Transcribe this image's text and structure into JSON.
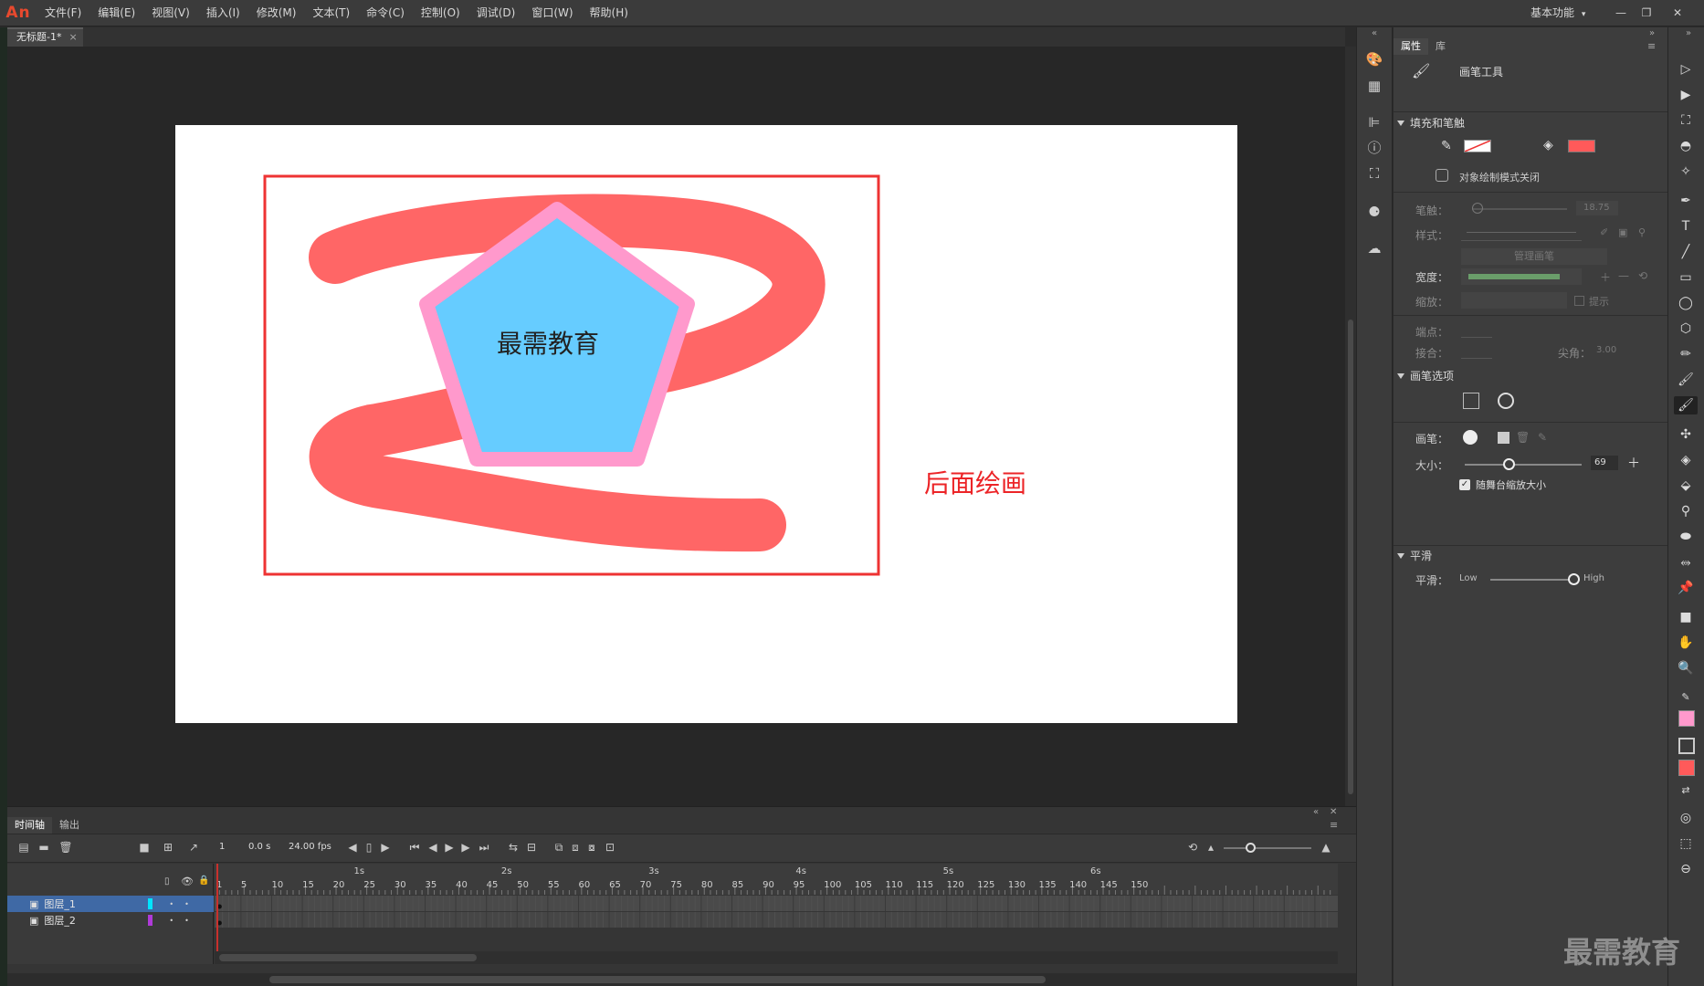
{
  "app": {
    "logo": "An",
    "workspace": "基本功能"
  },
  "menu": [
    "文件(F)",
    "编辑(E)",
    "视图(V)",
    "插入(I)",
    "修改(M)",
    "文本(T)",
    "命令(C)",
    "控制(O)",
    "调试(D)",
    "窗口(W)",
    "帮助(H)"
  ],
  "document": {
    "tab_title": "无标题-1*",
    "tab_close": "×"
  },
  "stage": {
    "shape_text": "最需教育",
    "annotation": "后面绘画",
    "colors": {
      "stroke": "#ff6666",
      "pentagon_fill": "#66ccff",
      "pentagon_stroke": "#ff99cc",
      "box": "#ee3333"
    }
  },
  "timeline": {
    "tabs": [
      "时间轴",
      "输出"
    ],
    "current_frame": "1",
    "time": "0.0 s",
    "fps": "24.00 fps",
    "seconds": [
      "1s",
      "2s",
      "3s",
      "4s",
      "5s",
      "6s"
    ],
    "frame_numbers": [
      "1",
      "5",
      "10",
      "15",
      "20",
      "25",
      "30",
      "35",
      "40",
      "45",
      "50",
      "55",
      "60",
      "65",
      "70",
      "75",
      "80",
      "85",
      "90",
      "95",
      "100",
      "105",
      "110",
      "115",
      "120",
      "125",
      "130",
      "135",
      "140",
      "145",
      "150"
    ],
    "layers": [
      {
        "name": "图层_1",
        "color": "#00e5ff",
        "selected": true
      },
      {
        "name": "图层_2",
        "color": "#b03ad9",
        "selected": false
      }
    ]
  },
  "properties": {
    "tabs": [
      "属性",
      "库"
    ],
    "tool_name": "画笔工具",
    "fill_stroke": {
      "header": "填充和笔触",
      "stroke_color": "none",
      "fill_color": "#ff5a5a",
      "draw_mode": "对象绘制模式关闭",
      "stroke_label": "笔触：",
      "stroke_value": "18.75",
      "style_label": "样式：",
      "manage_brush": "管理画笔",
      "width_label": "宽度：",
      "scale_label": "缩放：",
      "hint_label": "提示",
      "cap_label": "端点：",
      "join_label": "接合：",
      "miter_label": "尖角：",
      "miter_value": "3.00"
    },
    "brush_options": {
      "header": "画笔选项",
      "brush_label": "画笔：",
      "size_label": "大小：",
      "size_value": "69",
      "size_fraction": 0.38,
      "scale_with_stage": "随舞台缩放大小",
      "scale_checked": true
    },
    "smoothing": {
      "header": "平滑",
      "label": "平滑：",
      "low": "Low",
      "high": "High",
      "value_fraction": 1.0
    }
  },
  "watermark": "最需教育"
}
